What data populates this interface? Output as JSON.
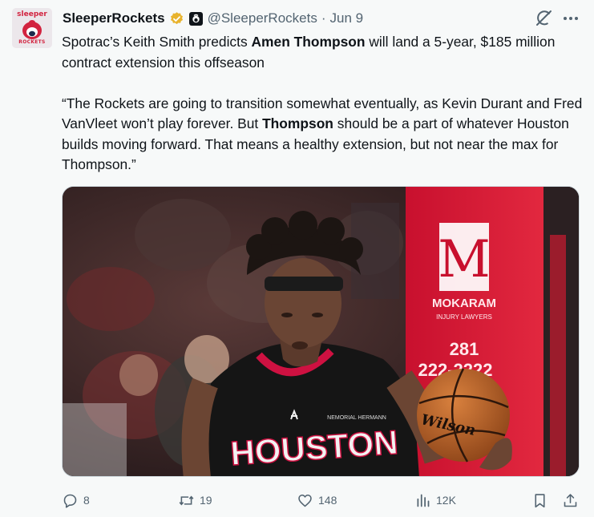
{
  "author": {
    "display_name": "SleeperRockets",
    "handle": "@SleeperRockets",
    "separator": "·",
    "date": "Jun 9",
    "avatar_text_top": "sleeper",
    "avatar_text_bottom": "ROCKETS",
    "verified_color": "#e8b32d"
  },
  "tweet": {
    "para1": [
      {
        "t": "Spotrac’s Keith Smith predicts ",
        "b": false
      },
      {
        "t": "Amen Thompson",
        "b": true
      },
      {
        "t": " will land a 5-year, $185 million contract extension this offseason",
        "b": false
      }
    ],
    "para2": [
      {
        "t": "“The Rockets are going to transition somewhat eventually, as Kevin Durant and Fred VanVleet won’t play forever. But ",
        "b": false
      },
      {
        "t": "Thompson",
        "b": true
      },
      {
        "t": " should be a part of whatever Houston builds moving forward. That means a healthy extension, but not near the max for Thompson.”",
        "b": false
      }
    ]
  },
  "media": {
    "jersey_text": "HOUSTON",
    "jersey_patch": "NEMORIAL HERMANN",
    "sign_logo": "M",
    "sign_line1": "MOKARAM",
    "sign_line2": "INJURY LAWYERS",
    "sign_phone1": "281",
    "sign_phone2": "222-2222",
    "ball_brand": "Wilson"
  },
  "actions": {
    "replies": "8",
    "reposts": "19",
    "likes": "148",
    "views": "12K"
  },
  "colors": {
    "icon": "#536471",
    "text": "#0f1419",
    "rockets_red": "#ce1141"
  }
}
